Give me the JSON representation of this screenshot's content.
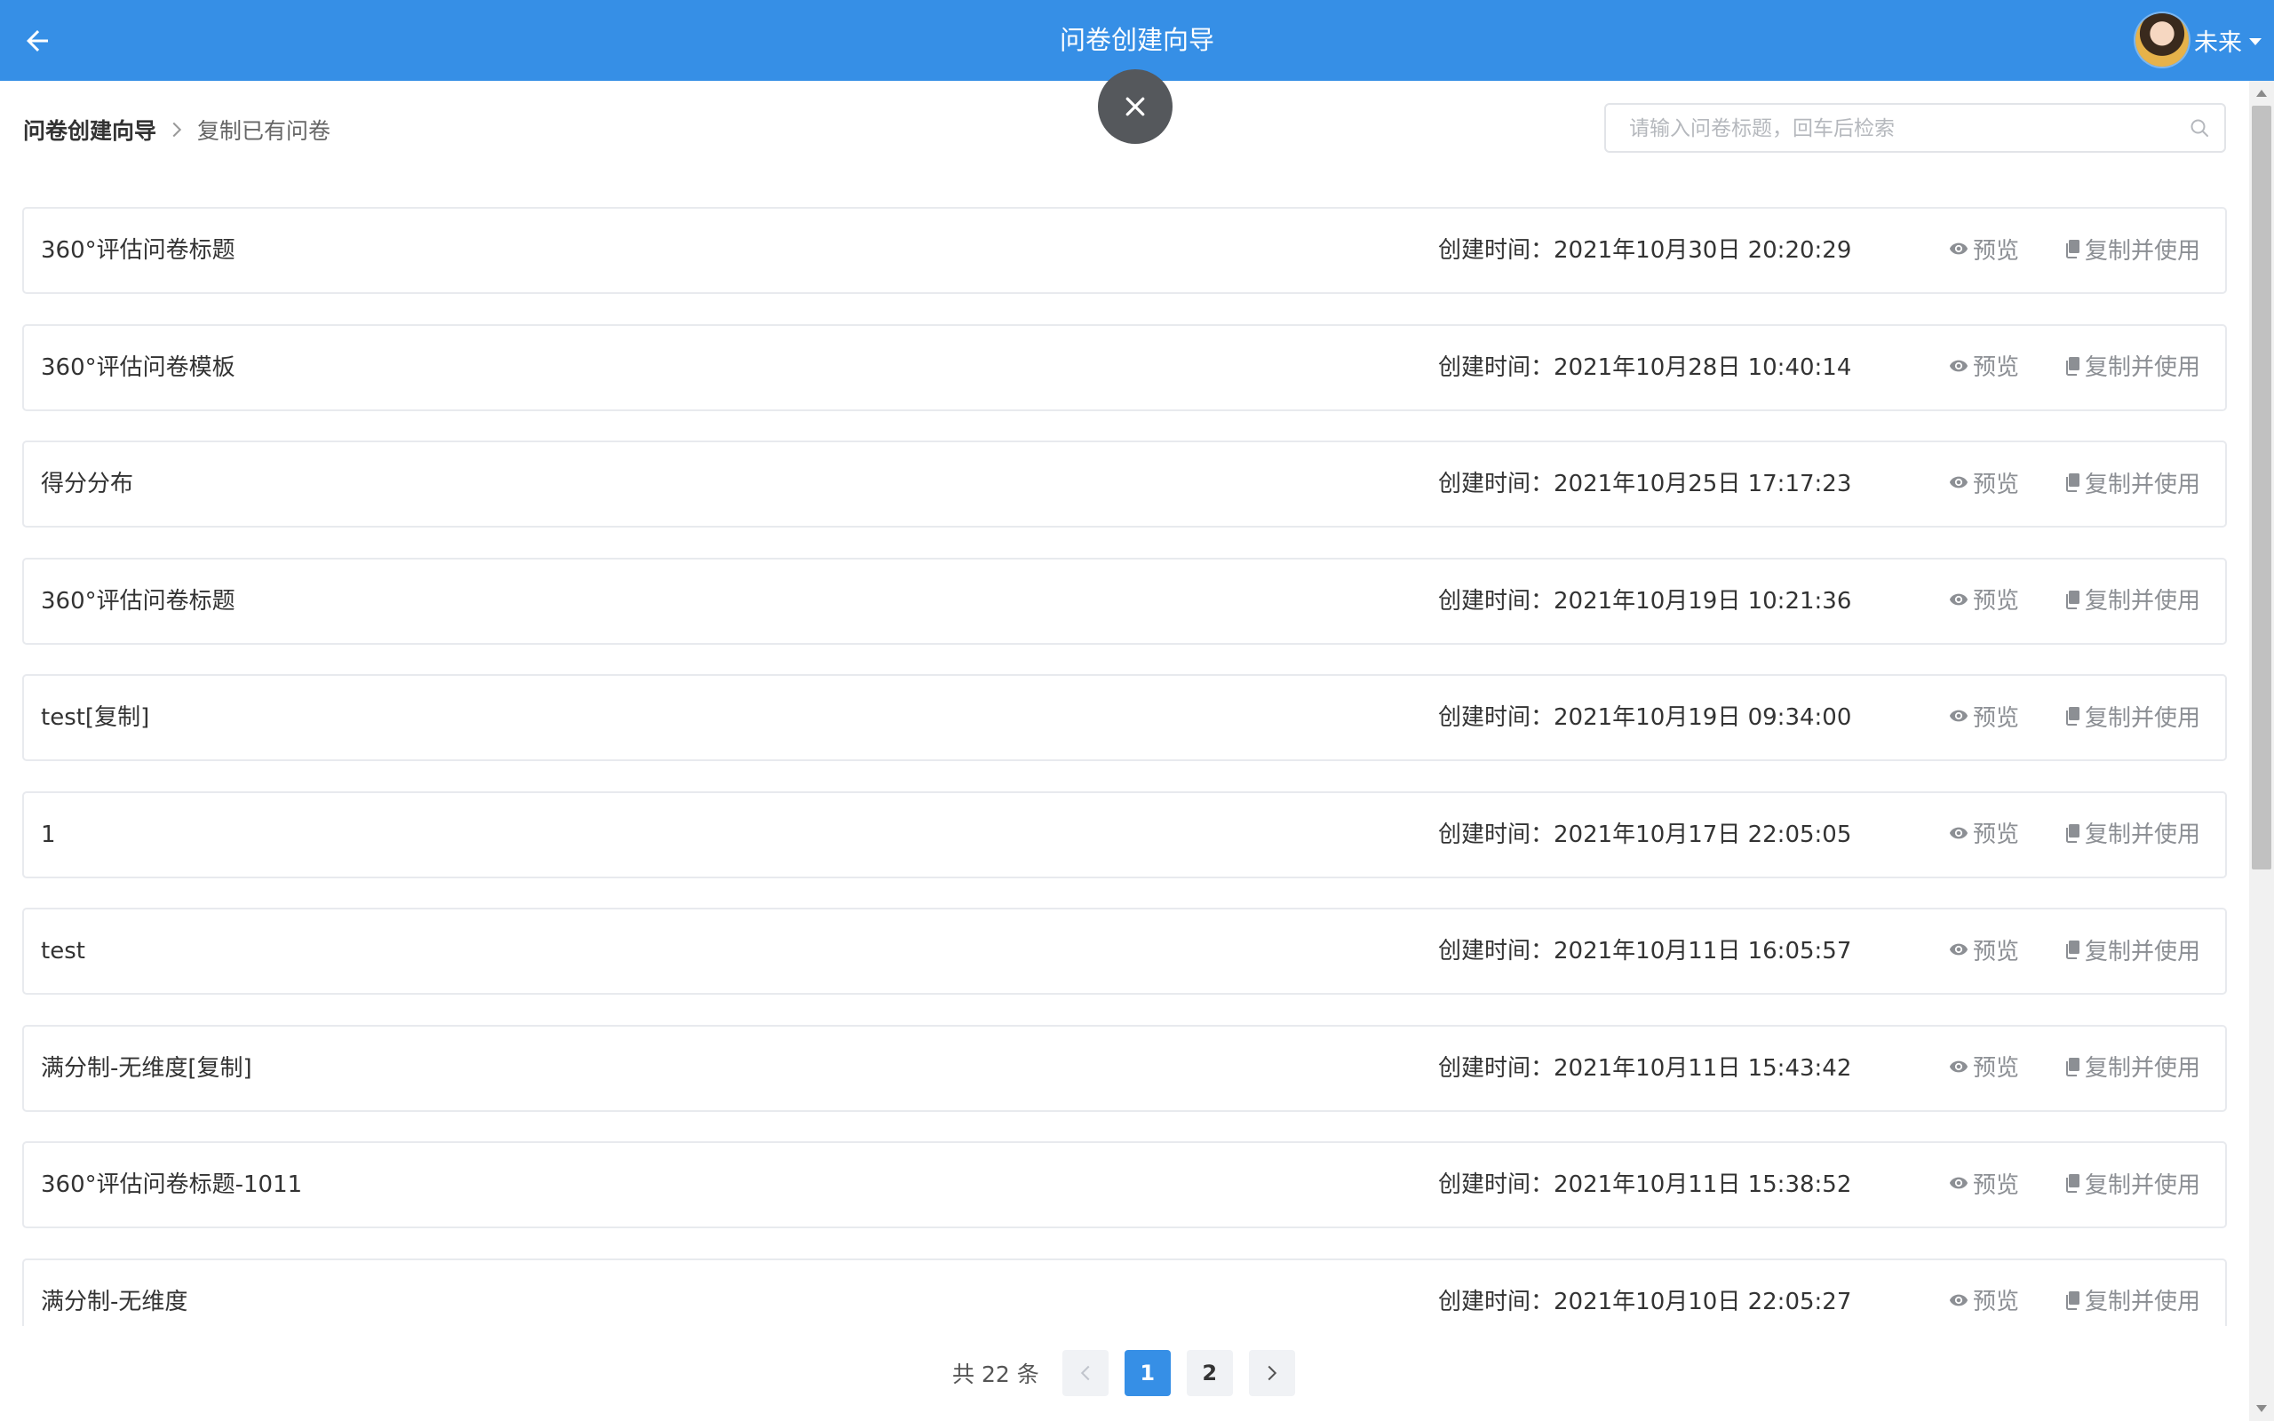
{
  "header": {
    "title": "问卷创建向导",
    "user_name": "未来"
  },
  "breadcrumb": {
    "root": "问卷创建向导",
    "current": "复制已有问卷"
  },
  "search": {
    "placeholder": "请输入问卷标题，回车后检索",
    "value": ""
  },
  "row_actions": {
    "preview": "预览",
    "copy_use": "复制并使用"
  },
  "surveys": [
    {
      "title": "360°评估问卷标题",
      "created": "创建时间：2021年10月30日 20:20:29"
    },
    {
      "title": "360°评估问卷模板",
      "created": "创建时间：2021年10月28日 10:40:14"
    },
    {
      "title": "得分分布",
      "created": "创建时间：2021年10月25日 17:17:23"
    },
    {
      "title": "360°评估问卷标题",
      "created": "创建时间：2021年10月19日 10:21:36"
    },
    {
      "title": "test[复制]",
      "created": "创建时间：2021年10月19日 09:34:00"
    },
    {
      "title": "1",
      "created": "创建时间：2021年10月17日 22:05:05"
    },
    {
      "title": "test",
      "created": "创建时间：2021年10月11日 16:05:57"
    },
    {
      "title": "满分制-无维度[复制]",
      "created": "创建时间：2021年10月11日 15:43:42"
    },
    {
      "title": "360°评估问卷标题-1011",
      "created": "创建时间：2021年10月11日 15:38:52"
    },
    {
      "title": "满分制-无维度",
      "created": "创建时间：2021年10月10日 22:05:27"
    }
  ],
  "pagination": {
    "total_text": "共 22 条",
    "pages": [
      "1",
      "2"
    ],
    "current": "1"
  },
  "colors": {
    "header": "#368fe6",
    "active_page": "#368fe6",
    "close_button": "#55585c"
  },
  "icons": {
    "back": "arrow-left-icon",
    "close": "close-icon",
    "search": "search-icon",
    "preview": "eye-icon",
    "copy": "copy-icon",
    "caret": "caret-down-icon"
  }
}
